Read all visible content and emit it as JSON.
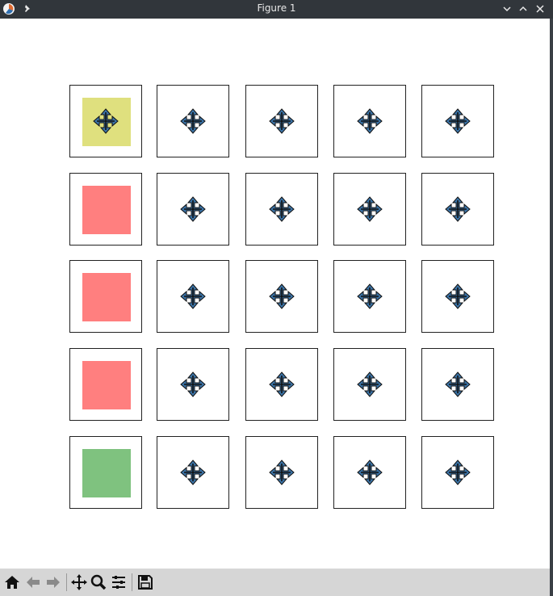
{
  "window": {
    "title": "Figure 1"
  },
  "colors": {
    "highlight": "#dfe07e",
    "red": "#ff7f7f",
    "green": "#7fc27f",
    "arrow_fill": "#3b73a6"
  },
  "grid": {
    "rows": 5,
    "cols": 5,
    "col0_swatches": [
      "yellow",
      "red",
      "red",
      "red",
      "green"
    ],
    "other_cells_icon": "move-icon"
  },
  "toolbar": {
    "buttons": [
      "home-icon",
      "back-icon",
      "forward-icon",
      "pan-icon",
      "zoom-icon",
      "configure-subplots-icon",
      "save-icon"
    ]
  }
}
